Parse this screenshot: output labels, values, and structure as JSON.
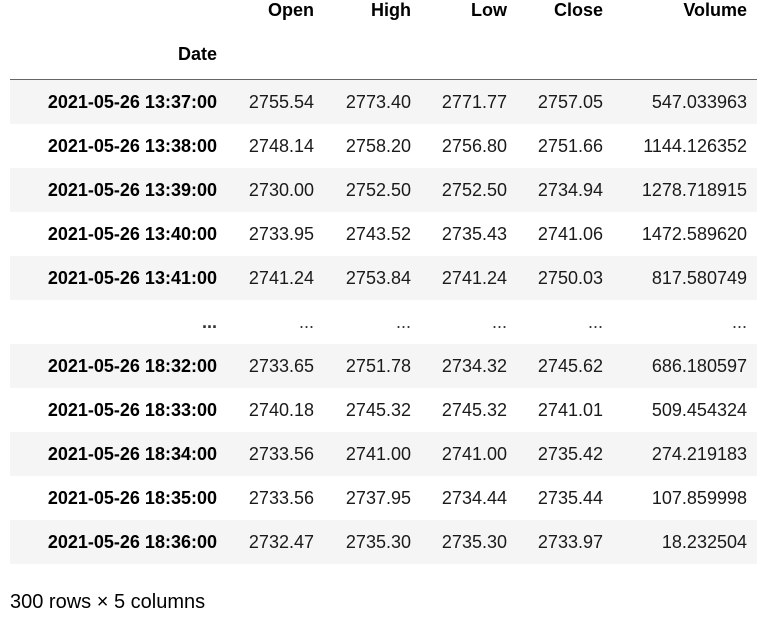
{
  "dataframe": {
    "columns": [
      "Open",
      "High",
      "Low",
      "Close",
      "Volume"
    ],
    "index_name": "Date",
    "rows": [
      {
        "index": "2021-05-26 13:37:00",
        "values": [
          "2755.54",
          "2773.40",
          "2771.77",
          "2757.05",
          "547.033963"
        ]
      },
      {
        "index": "2021-05-26 13:38:00",
        "values": [
          "2748.14",
          "2758.20",
          "2756.80",
          "2751.66",
          "1144.126352"
        ]
      },
      {
        "index": "2021-05-26 13:39:00",
        "values": [
          "2730.00",
          "2752.50",
          "2752.50",
          "2734.94",
          "1278.718915"
        ]
      },
      {
        "index": "2021-05-26 13:40:00",
        "values": [
          "2733.95",
          "2743.52",
          "2735.43",
          "2741.06",
          "1472.589620"
        ]
      },
      {
        "index": "2021-05-26 13:41:00",
        "values": [
          "2741.24",
          "2753.84",
          "2741.24",
          "2750.03",
          "817.580749"
        ]
      },
      {
        "index": "...",
        "values": [
          "...",
          "...",
          "...",
          "...",
          "..."
        ]
      },
      {
        "index": "2021-05-26 18:32:00",
        "values": [
          "2733.65",
          "2751.78",
          "2734.32",
          "2745.62",
          "686.180597"
        ]
      },
      {
        "index": "2021-05-26 18:33:00",
        "values": [
          "2740.18",
          "2745.32",
          "2745.32",
          "2741.01",
          "509.454324"
        ]
      },
      {
        "index": "2021-05-26 18:34:00",
        "values": [
          "2733.56",
          "2741.00",
          "2741.00",
          "2735.42",
          "274.219183"
        ]
      },
      {
        "index": "2021-05-26 18:35:00",
        "values": [
          "2733.56",
          "2737.95",
          "2734.44",
          "2735.44",
          "107.859998"
        ]
      },
      {
        "index": "2021-05-26 18:36:00",
        "values": [
          "2732.47",
          "2735.30",
          "2735.30",
          "2733.97",
          "18.232504"
        ]
      }
    ],
    "shape_note": "300 rows × 5 columns"
  },
  "colors": {
    "row_shade": "#f5f5f5",
    "header_border": "#666666",
    "text": "#000000"
  }
}
